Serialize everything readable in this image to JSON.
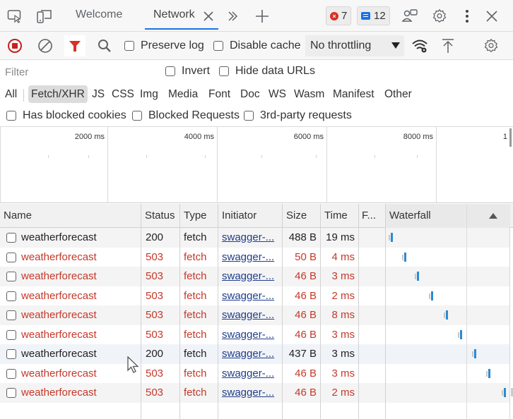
{
  "tabbar": {
    "icons": [
      "inspect-icon",
      "device-toggle-icon"
    ],
    "tabs": [
      {
        "label": "Welcome",
        "active": false
      },
      {
        "label": "Network",
        "active": true
      }
    ],
    "more_tabs_icon": "chevron-double-right-icon",
    "new_tab_icon": "plus-icon",
    "errors_count": "7",
    "messages_count": "12",
    "right_icons": [
      "feedback-icon",
      "settings-icon",
      "more-vert-icon",
      "close-icon"
    ]
  },
  "toolbar": {
    "record_icon": "record-stop-icon",
    "clear_icon": "clear-icon",
    "filter_icon": "filter-icon",
    "search_icon": "search-icon",
    "preserve_log_label": "Preserve log",
    "preserve_log_checked": false,
    "disable_cache_label": "Disable cache",
    "disable_cache_checked": false,
    "throttling_value": "No throttling",
    "network_conditions_icon": "wifi-settings-icon",
    "import_icon": "upload-icon",
    "settings_icon": "settings-icon"
  },
  "filter": {
    "placeholder": "Filter",
    "value": "",
    "invert_label": "Invert",
    "invert_checked": false,
    "hide_data_urls_label": "Hide data URLs",
    "hide_data_urls_checked": false
  },
  "types": {
    "items": [
      "All",
      "Fetch/XHR",
      "JS",
      "CSS",
      "Img",
      "Media",
      "Font",
      "Doc",
      "WS",
      "Wasm",
      "Manifest",
      "Other"
    ],
    "active": "Fetch/XHR"
  },
  "blocked": {
    "has_blocked_cookies_label": "Has blocked cookies",
    "blocked_requests_label": "Blocked Requests",
    "third_party_label": "3rd-party requests"
  },
  "overview": {
    "labels": [
      "2000 ms",
      "4000 ms",
      "6000 ms",
      "8000 ms",
      "1"
    ]
  },
  "table": {
    "columns": [
      "Name",
      "Status",
      "Type",
      "Initiator",
      "Size",
      "Time",
      "F...",
      "Waterfall"
    ],
    "sort_column": "Waterfall",
    "sort_direction": "ascending",
    "rows": [
      {
        "name": "weatherforecast",
        "status": "200",
        "type": "fetch",
        "initiator": "swagger-...",
        "size": "488 B",
        "time": "19 ms",
        "error": false
      },
      {
        "name": "weatherforecast",
        "status": "503",
        "type": "fetch",
        "initiator": "swagger-...",
        "size": "50 B",
        "time": "4 ms",
        "error": true
      },
      {
        "name": "weatherforecast",
        "status": "503",
        "type": "fetch",
        "initiator": "swagger-...",
        "size": "46 B",
        "time": "3 ms",
        "error": true
      },
      {
        "name": "weatherforecast",
        "status": "503",
        "type": "fetch",
        "initiator": "swagger-...",
        "size": "46 B",
        "time": "2 ms",
        "error": true
      },
      {
        "name": "weatherforecast",
        "status": "503",
        "type": "fetch",
        "initiator": "swagger-...",
        "size": "46 B",
        "time": "8 ms",
        "error": true
      },
      {
        "name": "weatherforecast",
        "status": "503",
        "type": "fetch",
        "initiator": "swagger-...",
        "size": "46 B",
        "time": "3 ms",
        "error": true
      },
      {
        "name": "weatherforecast",
        "status": "200",
        "type": "fetch",
        "initiator": "swagger-...",
        "size": "437 B",
        "time": "3 ms",
        "error": false
      },
      {
        "name": "weatherforecast",
        "status": "503",
        "type": "fetch",
        "initiator": "swagger-...",
        "size": "46 B",
        "time": "3 ms",
        "error": true
      },
      {
        "name": "weatherforecast",
        "status": "503",
        "type": "fetch",
        "initiator": "swagger-...",
        "size": "46 B",
        "time": "2 ms",
        "error": true
      }
    ],
    "waterfall_start_fraction": [
      0.02,
      0.13,
      0.24,
      0.36,
      0.48,
      0.6,
      0.72,
      0.84,
      0.97
    ]
  },
  "colors": {
    "accent": "#1a73e8",
    "error_text": "#c5382a",
    "record_red": "#c5221f",
    "filter_red": "#d93025",
    "waterfall_bar": "#2b8ad2",
    "link": "#1f3d8a"
  }
}
